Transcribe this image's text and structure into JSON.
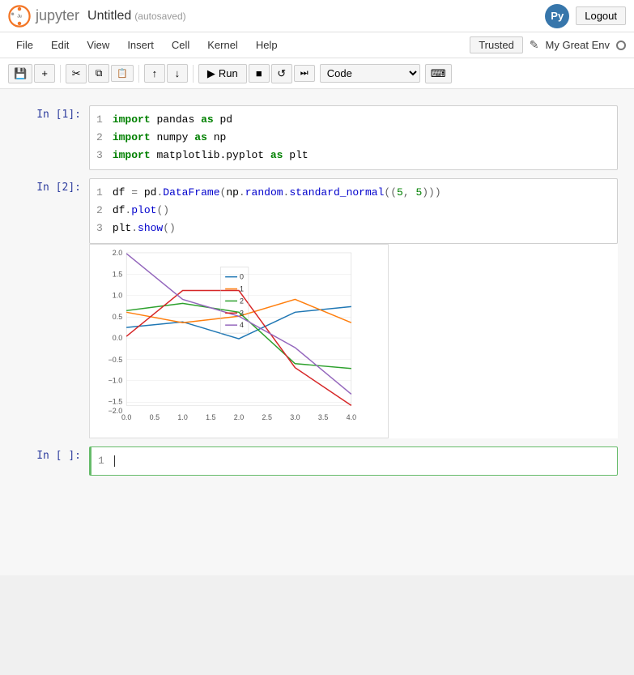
{
  "header": {
    "logo_text": "jupyter",
    "notebook_title": "Untitled",
    "autosaved": "(autosaved)",
    "python_icon_label": "Py",
    "logout_label": "Logout"
  },
  "menubar": {
    "items": [
      "File",
      "Edit",
      "View",
      "Insert",
      "Cell",
      "Kernel",
      "Help"
    ],
    "trusted_label": "Trusted",
    "pencil_symbol": "✎",
    "kernel_info": "My Great Env",
    "circle_symbol": "○"
  },
  "toolbar": {
    "buttons": [
      {
        "name": "save",
        "symbol": "💾"
      },
      {
        "name": "add-cell",
        "symbol": "+"
      },
      {
        "name": "cut",
        "symbol": "✂"
      },
      {
        "name": "copy",
        "symbol": "⎘"
      },
      {
        "name": "paste",
        "symbol": "📋"
      },
      {
        "name": "move-up",
        "symbol": "↑"
      },
      {
        "name": "move-down",
        "symbol": "↓"
      }
    ],
    "run_label": "Run",
    "stop_symbol": "■",
    "restart_symbol": "↺",
    "restart_run_symbol": "⏭",
    "cell_type": "Code",
    "keyboard_symbol": "⌨"
  },
  "cells": [
    {
      "prompt": "In [1]:",
      "lines": [
        {
          "num": 1,
          "code": "import pandas as pd"
        },
        {
          "num": 2,
          "code": "import numpy as np"
        },
        {
          "num": 3,
          "code": "import matplotlib.pyplot as plt"
        }
      ]
    },
    {
      "prompt": "In [2]:",
      "lines": [
        {
          "num": 1,
          "code": "df = pd.DataFrame(np.random.standard_normal((5, 5)))"
        },
        {
          "num": 2,
          "code": "df.plot()"
        },
        {
          "num": 3,
          "code": "plt.show()"
        }
      ]
    },
    {
      "prompt": "In [ ]:",
      "lines": [
        {
          "num": 1,
          "code": ""
        }
      ]
    }
  ],
  "chart": {
    "x_labels": [
      "0.0",
      "0.5",
      "1.0",
      "1.5",
      "2.0",
      "2.5",
      "3.0",
      "3.5",
      "4.0"
    ],
    "y_labels": [
      "2.0",
      "1.5",
      "1.0",
      "0.5",
      "0.0",
      "-0.5",
      "-1.0",
      "-1.5",
      "-2.0"
    ],
    "legend": [
      {
        "label": "0",
        "color": "#1f77b4"
      },
      {
        "label": "1",
        "color": "#ff7f0e"
      },
      {
        "label": "2",
        "color": "#2ca02c"
      },
      {
        "label": "3",
        "color": "#d62728"
      },
      {
        "label": "4",
        "color": "#9467bd"
      }
    ],
    "series": [
      {
        "color": "#1f77b4",
        "points": [
          [
            0,
            0.05
          ],
          [
            1,
            0.2
          ],
          [
            2,
            -0.25
          ],
          [
            3,
            0.45
          ],
          [
            4,
            0.6
          ]
        ]
      },
      {
        "color": "#ff7f0e",
        "points": [
          [
            0,
            0.45
          ],
          [
            1,
            0.15
          ],
          [
            2,
            0.35
          ],
          [
            3,
            0.8
          ],
          [
            4,
            0.15
          ]
        ]
      },
      {
        "color": "#2ca02c",
        "points": [
          [
            0,
            0.5
          ],
          [
            1,
            0.7
          ],
          [
            2,
            0.45
          ],
          [
            3,
            -0.55
          ],
          [
            4,
            -0.7
          ]
        ]
      },
      {
        "color": "#d62728",
        "points": [
          [
            0,
            -0.1
          ],
          [
            1,
            1.3
          ],
          [
            2,
            1.3
          ],
          [
            3,
            -0.7
          ],
          [
            4,
            -1.9
          ]
        ]
      },
      {
        "color": "#9467bd",
        "points": [
          [
            0,
            1.9
          ],
          [
            1,
            0.8
          ],
          [
            2,
            0.35
          ],
          [
            3,
            -0.3
          ],
          [
            4,
            -1.5
          ]
        ]
      }
    ]
  }
}
